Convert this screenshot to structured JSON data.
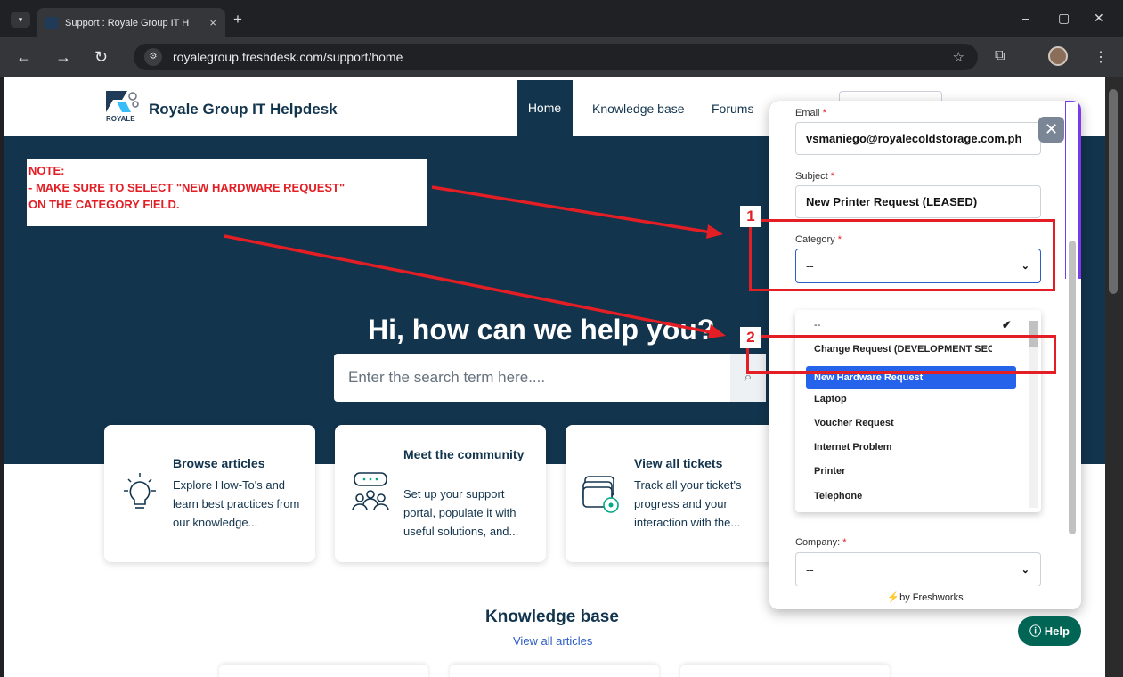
{
  "browser": {
    "tab_title": "Support : Royale Group IT H",
    "url": "royalegroup.freshdesk.com/support/home",
    "new_tab": "+",
    "close_tab": "×"
  },
  "site": {
    "brand": "Royale Group IT Helpdesk",
    "logo_text": "ROYALE",
    "nav": {
      "home": "Home",
      "knowledge_base": "Knowledge base",
      "forums": "Forums"
    },
    "hero_title": "Hi, how can we help you?",
    "search_placeholder": "Enter the search term here....",
    "cards": [
      {
        "title": "Browse articles",
        "desc": "Explore How-To's and learn best practices from our knowledge..."
      },
      {
        "title": "Meet the community",
        "desc": "Set up your support portal, populate it with useful solutions, and..."
      },
      {
        "title": "View all tickets",
        "desc": "Track all your ticket's progress and your interaction with the..."
      }
    ],
    "kb_title": "Knowledge base",
    "kb_link": "View all articles"
  },
  "note": {
    "line1": "NOTE:",
    "line2": "- MAKE SURE TO SELECT \"NEW HARDWARE REQUEST\"",
    "line3": "ON THE CATEGORY FIELD."
  },
  "annotations": {
    "step1": "1",
    "step2": "2"
  },
  "widget": {
    "email_label": "Email",
    "email_value": "vsmaniego@royalecoldstorage.com.ph",
    "subject_label": "Subject",
    "subject_value": "New Printer Request (LEASED)",
    "category_label": "Category",
    "category_value": "--",
    "required_mark": "*",
    "dropdown_options": [
      "--",
      "Change Request (DEVELOPMENT SECTION)",
      "New Hardware Request",
      "Laptop",
      "Voucher Request",
      "Internet Problem",
      "Printer",
      "Telephone"
    ],
    "selected_option": "New Hardware Request",
    "company_label": "Company:",
    "company_value": "--",
    "footer": "by Freshworks",
    "close": "✕"
  },
  "help_button": "Help",
  "colors": {
    "navy": "#12344d",
    "annotation_red": "#e31e24",
    "select_blue": "#2563eb",
    "help_green": "#006554"
  }
}
